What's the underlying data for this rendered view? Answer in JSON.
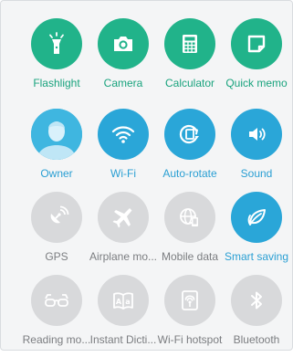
{
  "colors": {
    "green": "#21b38a",
    "blue": "#2aa6d8",
    "gray": "#d8d9db",
    "greenText": "#19a37d",
    "blueText": "#2a9fd3",
    "grayText": "#7b7d80"
  },
  "tiles": [
    {
      "label": "Flashlight",
      "icon": "flashlight-icon",
      "state": "green"
    },
    {
      "label": "Camera",
      "icon": "camera-icon",
      "state": "green"
    },
    {
      "label": "Calculator",
      "icon": "calculator-icon",
      "state": "green"
    },
    {
      "label": "Quick memo",
      "icon": "quick-memo-icon",
      "state": "green"
    },
    {
      "label": "Owner",
      "icon": "user-avatar-icon",
      "state": "blue"
    },
    {
      "label": "Wi-Fi",
      "icon": "wifi-icon",
      "state": "blue"
    },
    {
      "label": "Auto-rotate",
      "icon": "auto-rotate-icon",
      "state": "blue"
    },
    {
      "label": "Sound",
      "icon": "sound-icon",
      "state": "blue"
    },
    {
      "label": "GPS",
      "icon": "gps-icon",
      "state": "gray"
    },
    {
      "label": "Airplane mo...",
      "icon": "airplane-icon",
      "state": "gray"
    },
    {
      "label": "Mobile data",
      "icon": "mobile-data-icon",
      "state": "gray"
    },
    {
      "label": "Smart saving",
      "icon": "leaf-icon",
      "state": "blue"
    },
    {
      "label": "Reading mo...",
      "icon": "glasses-icon",
      "state": "gray"
    },
    {
      "label": "Instant Dicti...",
      "icon": "dictionary-icon",
      "state": "gray"
    },
    {
      "label": "Wi-Fi hotspot",
      "icon": "hotspot-icon",
      "state": "gray"
    },
    {
      "label": "Bluetooth",
      "icon": "bluetooth-icon",
      "state": "gray"
    }
  ]
}
